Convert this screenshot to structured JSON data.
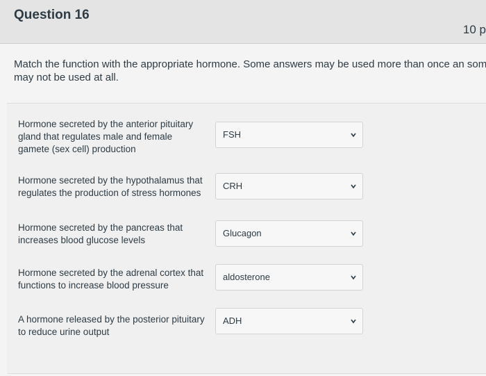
{
  "question": {
    "title": "Question 16",
    "points": "10 p",
    "text": "Match the function with the appropriate hormone. Some answers may be used more than once an some may not be used at all."
  },
  "matches": [
    {
      "prompt": "Hormone secreted by the anterior pituitary gland that regulates male and female gamete (sex cell) production",
      "selected": "FSH"
    },
    {
      "prompt": "Hormone secreted by the hypothalamus that regulates the production of stress hormones",
      "selected": "CRH"
    },
    {
      "prompt": "Hormone secreted by the pancreas that increases blood glucose levels",
      "selected": "Glucagon"
    },
    {
      "prompt": "Hormone secreted by the adrenal cortex that functions to increase blood pressure",
      "selected": "aldosterone"
    },
    {
      "prompt": "A hormone released by the posterior pituitary to reduce urine output",
      "selected": "ADH"
    }
  ],
  "icons": {
    "select_arrow": "chevron-down-icon"
  }
}
